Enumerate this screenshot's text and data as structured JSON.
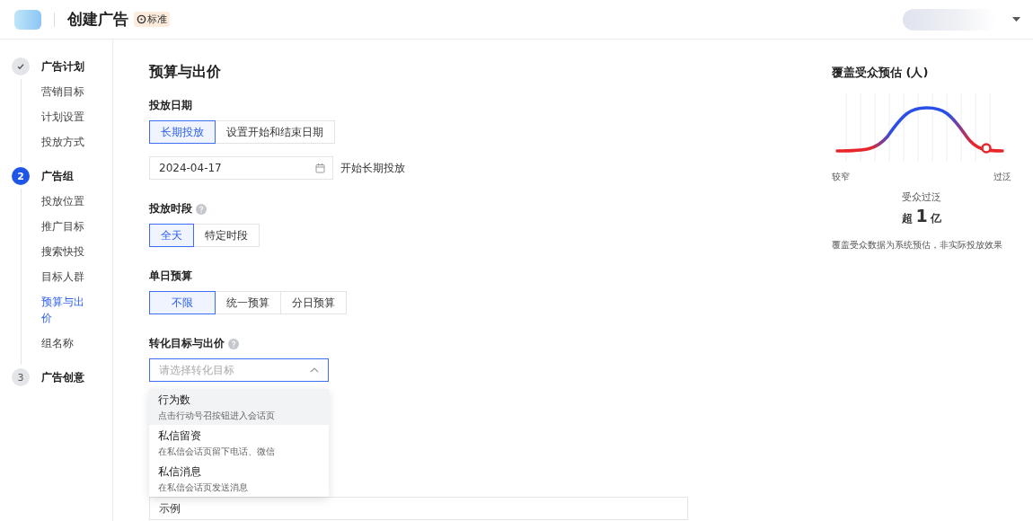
{
  "header": {
    "title": "创建广告",
    "badge": "标准"
  },
  "steps": [
    {
      "kind": "check",
      "selected": false,
      "title": "广告计划",
      "items": [
        {
          "label": "营销目标",
          "selected": false
        },
        {
          "label": "计划设置",
          "selected": false
        },
        {
          "label": "投放方式",
          "selected": false
        }
      ]
    },
    {
      "kind": "number",
      "selected": true,
      "number": "2",
      "title": "广告组",
      "items": [
        {
          "label": "投放位置",
          "selected": false
        },
        {
          "label": "推广目标",
          "selected": false
        },
        {
          "label": "搜索快投",
          "selected": false
        },
        {
          "label": "目标人群",
          "selected": false
        },
        {
          "label": "预算与出价",
          "selected": true
        },
        {
          "label": "组名称",
          "selected": false
        }
      ]
    },
    {
      "kind": "number",
      "selected": false,
      "number": "3",
      "title": "广告创意"
    }
  ],
  "section_title": "预算与出价",
  "fields": [
    {
      "kind": "segmented",
      "label": "投放日期",
      "help": false,
      "options": [
        {
          "label": "长期投放",
          "selected": true
        },
        {
          "label": "设置开始和结束日期",
          "selected": false
        }
      ]
    },
    {
      "kind": "date",
      "value": "2024-04-17",
      "suffix": "开始长期投放"
    },
    {
      "kind": "segmented",
      "label": "投放时段",
      "help": true,
      "options": [
        {
          "label": "全天",
          "selected": true
        },
        {
          "label": "特定时段",
          "selected": false
        }
      ]
    },
    {
      "kind": "segmented",
      "label": "单日预算",
      "help": false,
      "options": [
        {
          "label": "不限",
          "selected": true
        },
        {
          "label": "统一预算",
          "selected": false
        },
        {
          "label": "分日预算",
          "selected": false
        }
      ]
    },
    {
      "kind": "select",
      "label": "转化目标与出价",
      "help": true,
      "placeholder": "请选择转化目标",
      "expanded": true,
      "options": [
        {
          "title": "行为数",
          "description": "点击行动号召按钮进入会话页",
          "highlighted": true
        },
        {
          "title": "私信留资",
          "description": "在私信会话页留下电话、微信",
          "highlighted": false
        },
        {
          "title": "私信消息",
          "description": "在私信会话页发送消息",
          "highlighted": false
        }
      ]
    },
    {
      "kind": "text",
      "value": "示例"
    }
  ],
  "audience": {
    "title": "覆盖受众预估 (人)",
    "axis_left": "较窄",
    "axis_right": "过泛",
    "status": "受众过泛",
    "amount_prefix": "超",
    "amount": "1",
    "amount_unit": "亿",
    "note": "覆盖受众数据为系统预估，非实际投放效果"
  }
}
